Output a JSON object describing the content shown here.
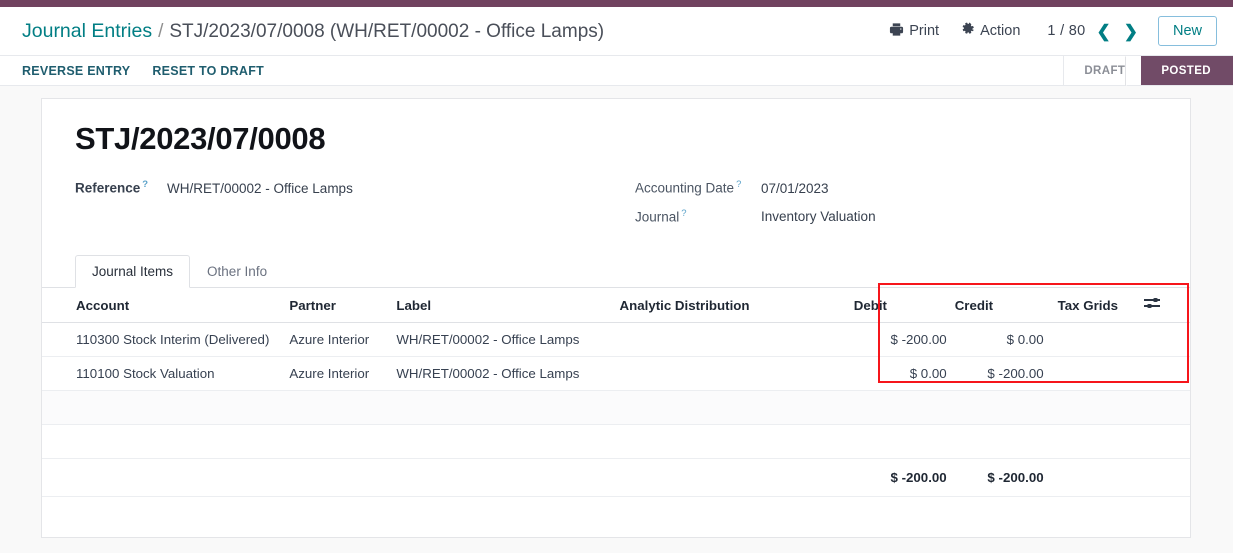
{
  "breadcrumb": {
    "root": "Journal Entries",
    "separator": "/",
    "current": "STJ/2023/07/0008 (WH/RET/00002 - Office Lamps)"
  },
  "control_panel": {
    "print_label": "Print",
    "print_icon": "printer-icon",
    "action_label": "Action",
    "action_icon": "gear-icon",
    "pager": "1 / 80",
    "pager_prev_icon": "chevron-left-icon",
    "pager_next_icon": "chevron-right-icon",
    "new_label": "New"
  },
  "action_bar": {
    "buttons": [
      {
        "label": "REVERSE ENTRY"
      },
      {
        "label": "RESET TO DRAFT"
      }
    ],
    "statuses": [
      {
        "label": "DRAFT",
        "active": false
      },
      {
        "label": "POSTED",
        "active": true
      }
    ]
  },
  "record": {
    "title": "STJ/2023/07/0008",
    "fields_left": [
      {
        "label": "Reference",
        "help": "?",
        "value": "WH/RET/00002 - Office Lamps",
        "bold": true
      }
    ],
    "fields_right": [
      {
        "label": "Accounting Date",
        "help": "?",
        "value": "07/01/2023",
        "bold": false
      },
      {
        "label": "Journal",
        "help": "?",
        "value": "Inventory Valuation",
        "bold": false
      }
    ]
  },
  "notebook": {
    "tabs": [
      {
        "label": "Journal Items",
        "active": true
      },
      {
        "label": "Other Info",
        "active": false
      }
    ]
  },
  "journal_items": {
    "columns": {
      "account": "Account",
      "partner": "Partner",
      "label": "Label",
      "analytic": "Analytic Distribution",
      "debit": "Debit",
      "credit": "Credit",
      "tax_grids": "Tax Grids",
      "options_icon": "sliders-icon"
    },
    "rows": [
      {
        "account": "110300 Stock Interim (Delivered)",
        "partner": "Azure Interior",
        "label": "WH/RET/00002 - Office Lamps",
        "analytic": "",
        "debit": "$ -200.00",
        "credit": "$ 0.00",
        "tax_grids": ""
      },
      {
        "account": "110100 Stock Valuation",
        "partner": "Azure Interior",
        "label": "WH/RET/00002 - Office Lamps",
        "analytic": "",
        "debit": "$ 0.00",
        "credit": "$ -200.00",
        "tax_grids": ""
      }
    ],
    "totals": {
      "debit": "$ -200.00",
      "credit": "$ -200.00"
    }
  },
  "annotation": {
    "highlight_color": "#f6151b",
    "highlight_target": "debit-credit-columns"
  },
  "theme": {
    "brand_purple": "#714b67",
    "top_strip": "#71425f",
    "link_teal": "#017e84",
    "status_active_bg": "#714b67",
    "sheet_bg": "#ffffff",
    "page_bg": "#f9f9f9"
  }
}
